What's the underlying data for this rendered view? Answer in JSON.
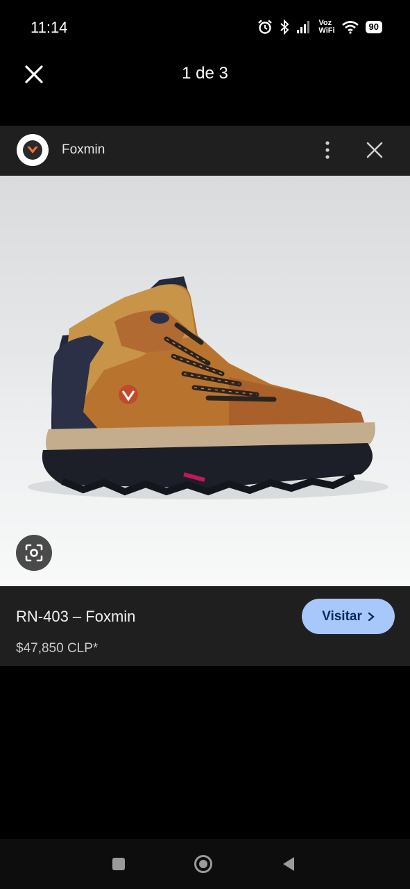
{
  "status_bar": {
    "time": "11:14",
    "voz": "Voz",
    "wifi_label": "WiFi",
    "battery": "90",
    "icons": [
      "alarm-icon",
      "bluetooth-icon",
      "signal-icon",
      "wifi-icon",
      "battery-icon"
    ]
  },
  "viewer": {
    "counter": "1 de 3",
    "close_icon": "close-icon"
  },
  "source": {
    "name": "Foxmin",
    "logo_icon": "foxmin-logo",
    "menu_icon": "more-vert-icon",
    "close_icon": "close-icon"
  },
  "image": {
    "subject": "work boot",
    "lens_icon": "google-lens-icon"
  },
  "product": {
    "title": "RN-403 – Foxmin",
    "price": "$47,850 CLP*",
    "visit_label": "Visitar",
    "visit_icon": "chevron-right-icon"
  },
  "nav": {
    "icons": [
      "recents-icon",
      "home-icon",
      "back-icon"
    ]
  },
  "colors": {
    "accent_button": "#a8c7fa",
    "panel": "#1f1f1f",
    "background": "#000000"
  }
}
